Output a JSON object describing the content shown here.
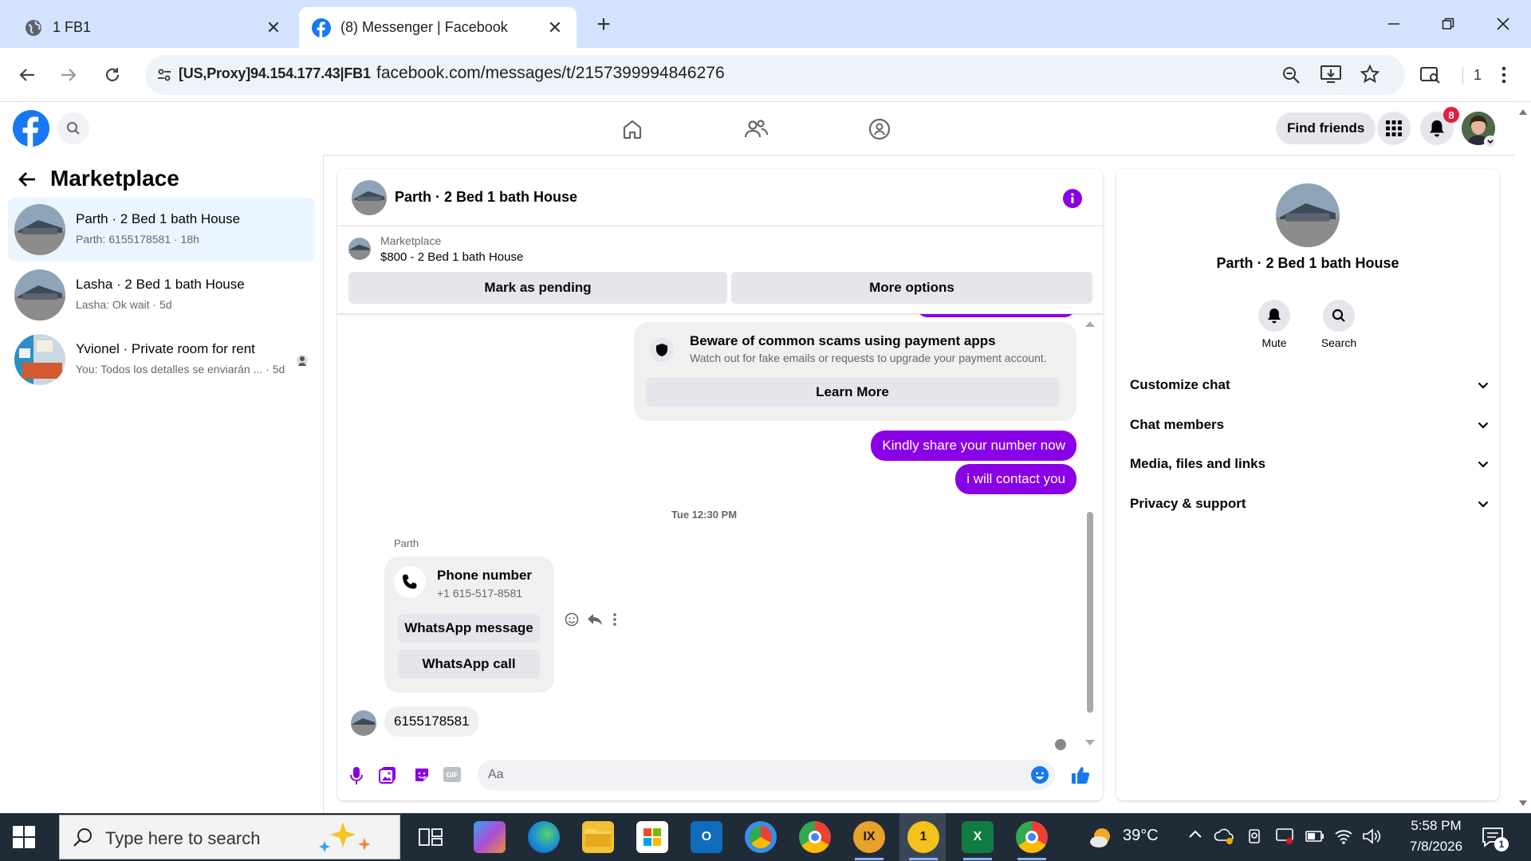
{
  "browser": {
    "tabs": [
      {
        "title": "1 FB1",
        "active": false
      },
      {
        "title": "(8) Messenger | Facebook",
        "active": true
      }
    ],
    "proxy_label": "[US,Proxy]94.154.177.43|FB1",
    "url": "facebook.com/messages/t/2157399994846276",
    "profile_count": "1"
  },
  "fb_header": {
    "find_friends": "Find friends",
    "notification_count": "8"
  },
  "sidebar": {
    "title": "Marketplace",
    "conversations": [
      {
        "name": "Parth · 2 Bed 1 bath House",
        "snippet": "Parth: 6155178581 · 18h",
        "selected": true
      },
      {
        "name": "Lasha · 2 Bed 1 bath House",
        "snippet": "Lasha: Ok wait · 5d",
        "selected": false
      },
      {
        "name": "Yvionel · Private room for rent",
        "snippet": "You: Todos los detalles se enviarán ... · 5d",
        "selected": false
      }
    ]
  },
  "chat": {
    "title": "Parth · 2 Bed 1 bath House",
    "listing_source": "Marketplace",
    "listing_price_title": "$800 - 2 Bed 1 bath House",
    "mark_pending": "Mark as pending",
    "more_options": "More options",
    "scam_notice": {
      "title": "Beware of common scams using payment apps",
      "body": "Watch out for fake emails or requests to upgrade your payment account.",
      "button": "Learn More"
    },
    "outgoing": [
      "Kindly share your number now",
      "i will contact you"
    ],
    "timestamp": "Tue 12:30 PM",
    "sender_name": "Parth",
    "phone_card": {
      "title": "Phone number",
      "number": "+1 615-517-8581",
      "whatsapp_message": "WhatsApp message",
      "whatsapp_call": "WhatsApp call"
    },
    "incoming_text": "6155178581",
    "composer_placeholder": "Aa",
    "accent_color": "#8a00e6"
  },
  "info_panel": {
    "title": "Parth · 2 Bed 1 bath House",
    "mute": "Mute",
    "search": "Search",
    "sections": [
      "Customize chat",
      "Chat members",
      "Media, files and links",
      "Privacy & support"
    ]
  },
  "taskbar": {
    "search_placeholder": "Type here to search",
    "weather": "39°C",
    "time": "5:58 PM",
    "date": "7/8/2026",
    "notification_badge": "1"
  }
}
